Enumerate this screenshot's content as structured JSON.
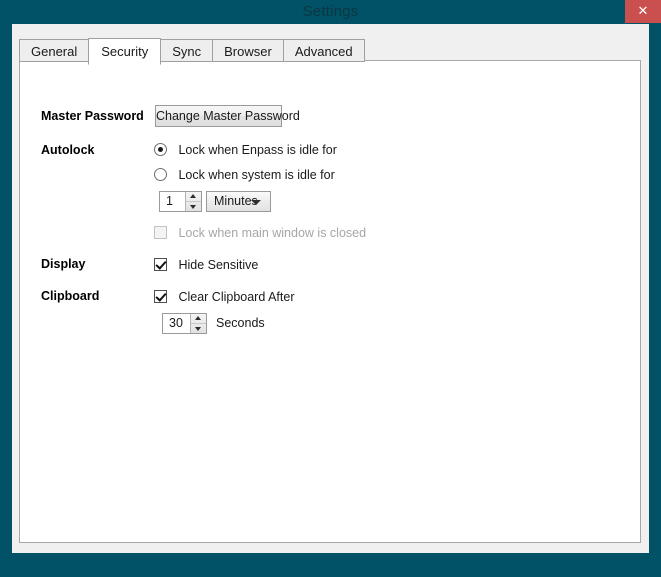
{
  "window": {
    "title": "Settings",
    "close_label": "✕",
    "accent_teal": "#015266",
    "close_red": "#c9504f"
  },
  "tabs": [
    {
      "label": "General",
      "selected": false
    },
    {
      "label": "Security",
      "selected": true
    },
    {
      "label": "Sync",
      "selected": false
    },
    {
      "label": "Browser",
      "selected": false
    },
    {
      "label": "Advanced",
      "selected": false
    }
  ],
  "sections": {
    "master_password": {
      "label": "Master Password",
      "button_label": "Change Master Password"
    },
    "autolock": {
      "label": "Autolock",
      "radio_enpass_idle": "Lock when Enpass is idle for",
      "radio_system_idle": "Lock when system is idle for",
      "idle_value": "1",
      "idle_unit": "Minutes",
      "checkbox_main_window_closed": "Lock when main window is closed"
    },
    "display": {
      "label": "Display",
      "checkbox_hide_sensitive": "Hide Sensitive"
    },
    "clipboard": {
      "label": "Clipboard",
      "checkbox_clear_clipboard": "Clear Clipboard After",
      "clear_value": "30",
      "clear_unit": "Seconds"
    }
  }
}
